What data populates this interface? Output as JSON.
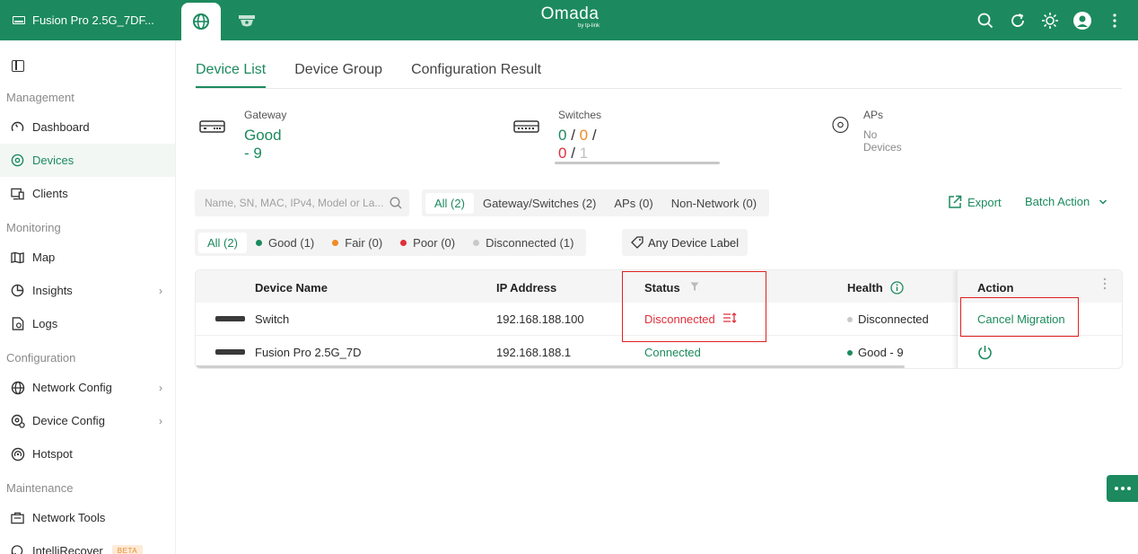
{
  "topbar": {
    "site_name": "Fusion Pro 2.5G_7DF...",
    "logo_text": "Omada",
    "logo_sub": "by tp-link"
  },
  "sidebar": {
    "sections": [
      {
        "title": "Management",
        "items": [
          {
            "label": "Dashboard",
            "icon": "dashboard-icon"
          },
          {
            "label": "Devices",
            "icon": "devices-icon",
            "active": true
          },
          {
            "label": "Clients",
            "icon": "clients-icon"
          }
        ]
      },
      {
        "title": "Monitoring",
        "items": [
          {
            "label": "Map",
            "icon": "map-icon"
          },
          {
            "label": "Insights",
            "icon": "insights-icon"
          },
          {
            "label": "Logs",
            "icon": "logs-icon"
          }
        ]
      },
      {
        "title": "Configuration",
        "items": [
          {
            "label": "Network Config",
            "icon": "network-icon"
          },
          {
            "label": "Device Config",
            "icon": "device-config-icon"
          },
          {
            "label": "Hotspot",
            "icon": "hotspot-icon"
          }
        ]
      },
      {
        "title": "Maintenance",
        "items": [
          {
            "label": "Network Tools",
            "icon": "tools-icon"
          },
          {
            "label": "IntelliRecover",
            "icon": "recover-icon",
            "badge": "BETA"
          }
        ]
      }
    ]
  },
  "tabs": [
    "Device List",
    "Device Group",
    "Configuration Result"
  ],
  "summary": {
    "gateway": {
      "label": "Gateway",
      "value": "Good - 9"
    },
    "switches": {
      "label": "Switches",
      "v1": "0",
      "v2": "0",
      "v3": "0",
      "v4": "1",
      "sep": "/"
    },
    "aps": {
      "label": "APs",
      "sub": "No Devices"
    }
  },
  "search": {
    "placeholder": "Name, SN, MAC, IPv4, Model or La..."
  },
  "type_filters": [
    "All (2)",
    "Gateway/Switches (2)",
    "APs (0)",
    "Non-Network (0)"
  ],
  "status_filters": [
    "All (2)",
    "Good (1)",
    "Fair (0)",
    "Poor (0)",
    "Disconnected (1)"
  ],
  "device_label_btn": "Any Device Label",
  "export_label": "Export",
  "batch_label": "Batch Action",
  "table": {
    "headers": {
      "name": "Device Name",
      "ip": "IP Address",
      "status": "Status",
      "health": "Health",
      "action": "Action"
    },
    "rows": [
      {
        "name": "Switch",
        "ip": "192.168.188.100",
        "status": "Disconnected",
        "health": "Disconnected",
        "action": "Cancel Migration"
      },
      {
        "name": "Fusion Pro 2.5G_7D",
        "ip": "192.168.188.1",
        "status": "Connected",
        "health": "Good - 9",
        "action": ""
      }
    ]
  },
  "colors": {
    "brand": "#1c8a5e",
    "danger": "#e0303c",
    "warning": "#f08a24",
    "muted": "#c0c0c0"
  }
}
